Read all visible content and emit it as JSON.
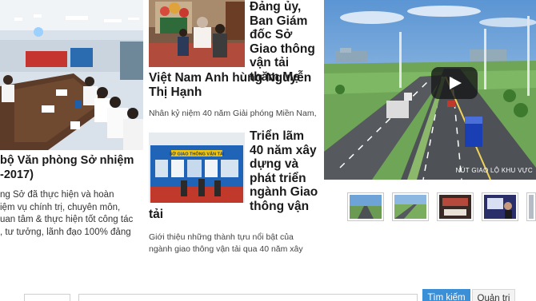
{
  "left_article": {
    "title": "bộ Văn phòng Sở nhiệm\n-2017)",
    "summary": "ng Sở đã thực hiện và hoàn\niệm vụ chính trị, chuyên môn,\nuan tâm & thực hiện tốt công tác\n, tư tưởng, lãnh đạo 100% đảng"
  },
  "middle_articles": [
    {
      "title_right": "Đảng ủy,\nBan Giám\nđốc Sở\nGiao thông\nvận tải\nthăm Mẹ",
      "title_below": "Việt Nam Anh hùng Nguyễn\nThị Hạnh",
      "summary": "Nhân kỷ niệm 40 năm Giải phóng Miền Nam,"
    },
    {
      "title_right": "Triển lãm\n40 năm xây\ndựng và\nphát triển\nngành Giao\nthông vận",
      "title_below": "tải",
      "summary": "Giới thiệu những thành tựu nổi bật của\nngành giao thông vận tải qua 40 năm xây",
      "image_sign": "SỞ GIAO THÔNG VẬN TẢI"
    }
  ],
  "video": {
    "caption": "NÚT GIAO LỘ KHU VỰC",
    "play_icon": "play-icon"
  },
  "thumbnails": [
    "road-aerial",
    "highway-rendering",
    "meeting-room",
    "presenter-slide",
    "partial-thumb"
  ],
  "search": {
    "button_label": "Tìm kiếm",
    "admin_label": "Quản trị"
  },
  "colors": {
    "accent_blue": "#3b8fd6",
    "title_text": "#1a1a1a"
  }
}
